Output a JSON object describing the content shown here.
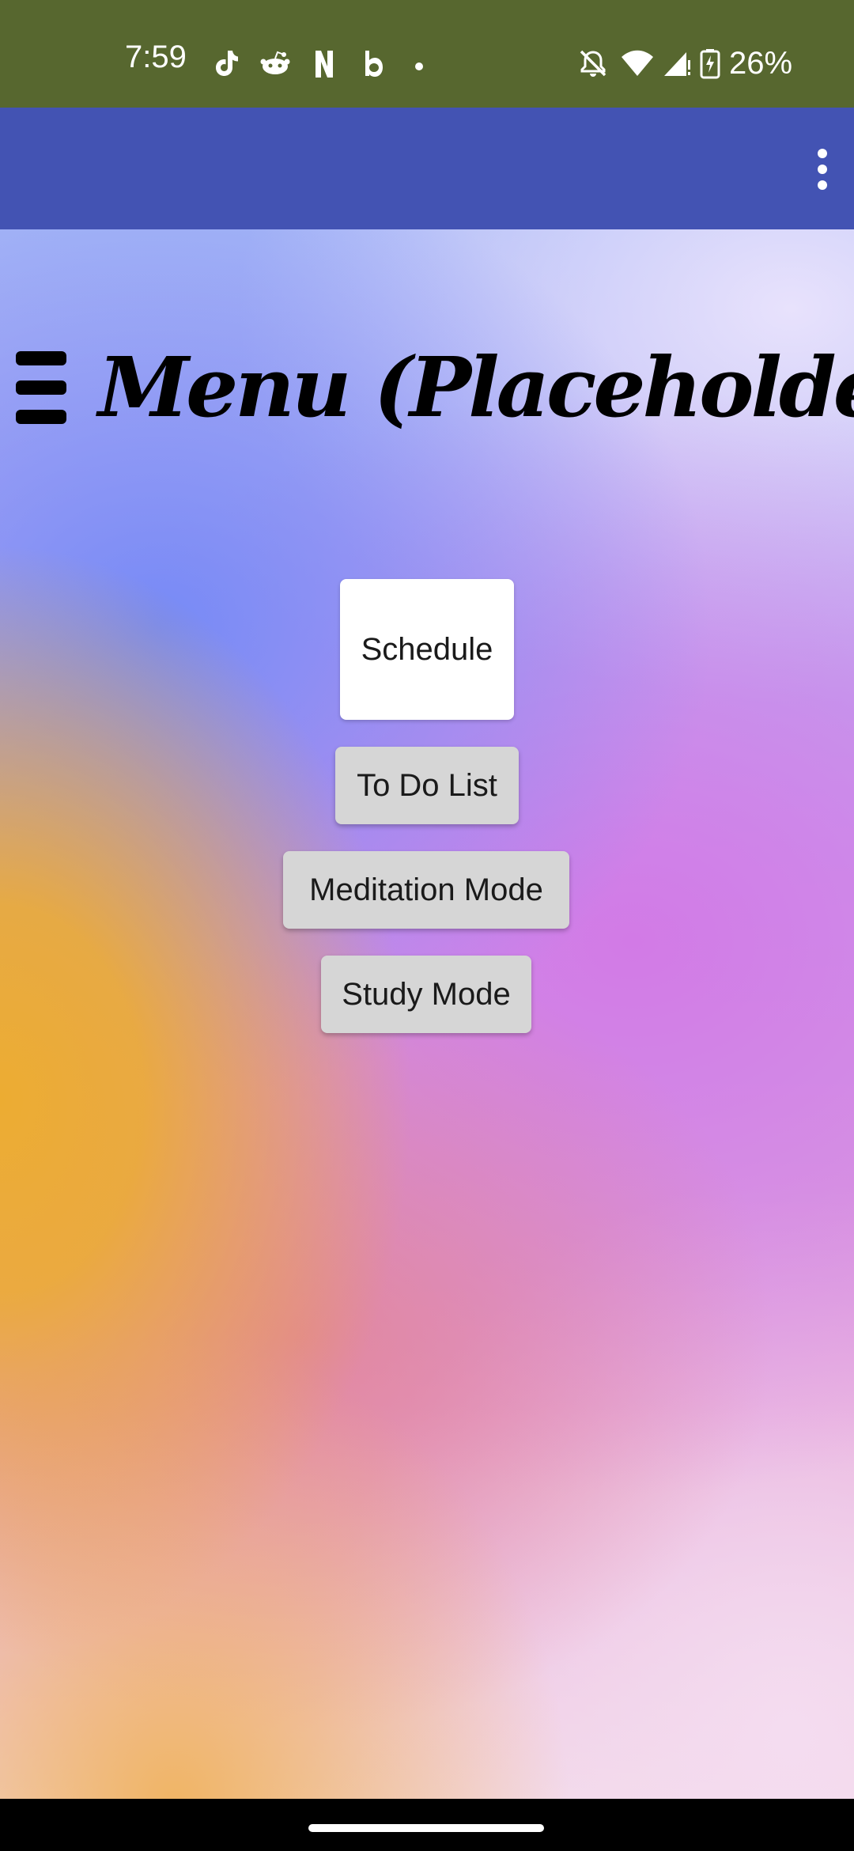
{
  "status_bar": {
    "time": "7:59",
    "battery_percent": "26%",
    "notification_icons": [
      "tiktok-icon",
      "reddit-icon",
      "netflix-icon",
      "bereal-icon",
      "dot-icon"
    ],
    "system_icons": [
      "bell-off-icon",
      "wifi-icon",
      "signal-icon",
      "battery-charging-icon"
    ]
  },
  "app_bar": {
    "overflow_icon": "more-vert-icon",
    "color": "#4353b3"
  },
  "header": {
    "menu_icon": "hamburger-icon",
    "title": "Menu (Placeholder)"
  },
  "buttons": {
    "schedule": "Schedule",
    "todo": "To Do List",
    "meditation": "Meditation Mode",
    "study": "Study Mode"
  },
  "colors": {
    "status_bar": "#57672f",
    "app_bar": "#4353b3"
  }
}
